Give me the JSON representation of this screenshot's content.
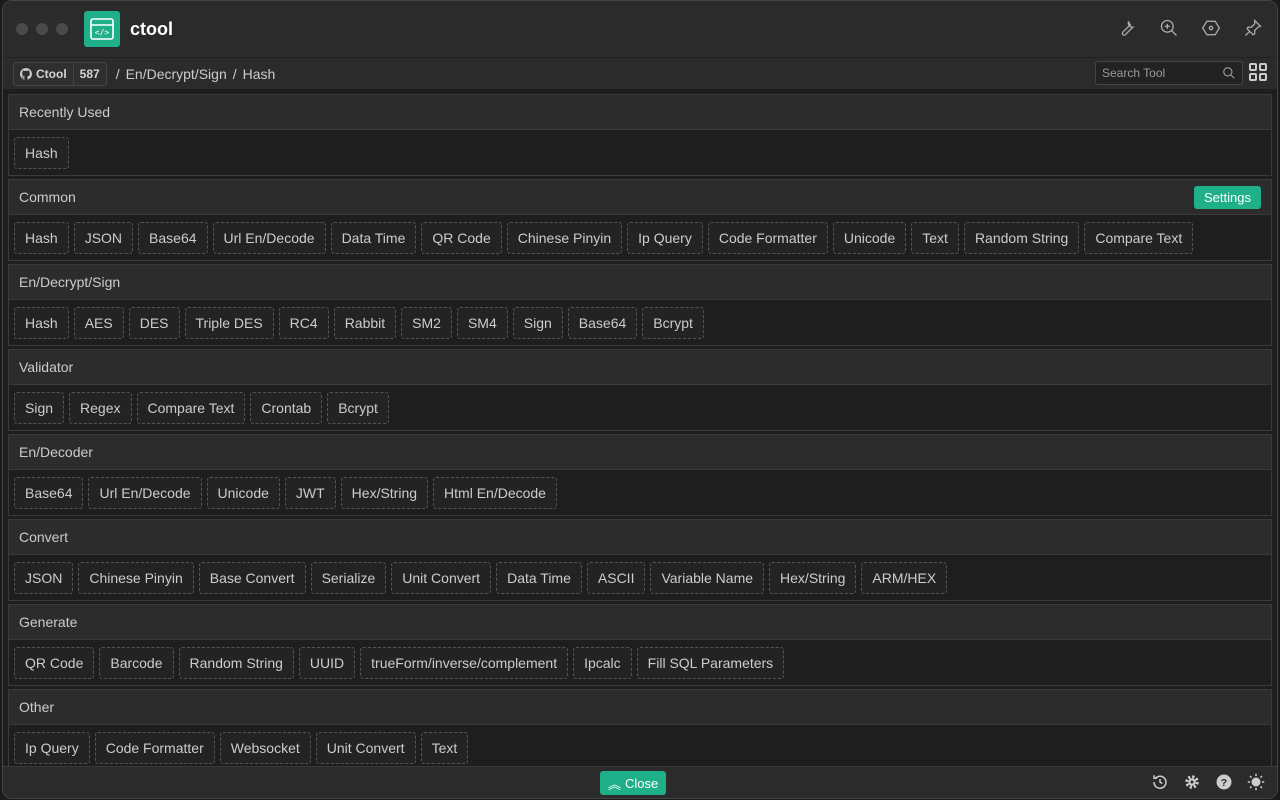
{
  "app": {
    "title": "ctool"
  },
  "nav": {
    "repo": "Ctool",
    "stars": "587",
    "breadcrumb": [
      "En/Decrypt/Sign",
      "Hash"
    ],
    "search_placeholder": "Search Tool"
  },
  "sections": [
    {
      "title": "Recently Used",
      "tools": [
        "Hash"
      ]
    },
    {
      "title": "Common",
      "action": "Settings",
      "tools": [
        "Hash",
        "JSON",
        "Base64",
        "Url En/Decode",
        "Data Time",
        "QR Code",
        "Chinese Pinyin",
        "Ip Query",
        "Code Formatter",
        "Unicode",
        "Text",
        "Random String",
        "Compare Text"
      ]
    },
    {
      "title": "En/Decrypt/Sign",
      "tools": [
        "Hash",
        "AES",
        "DES",
        "Triple DES",
        "RC4",
        "Rabbit",
        "SM2",
        "SM4",
        "Sign",
        "Base64",
        "Bcrypt"
      ]
    },
    {
      "title": "Validator",
      "tools": [
        "Sign",
        "Regex",
        "Compare Text",
        "Crontab",
        "Bcrypt"
      ]
    },
    {
      "title": "En/Decoder",
      "tools": [
        "Base64",
        "Url En/Decode",
        "Unicode",
        "JWT",
        "Hex/String",
        "Html En/Decode"
      ]
    },
    {
      "title": "Convert",
      "tools": [
        "JSON",
        "Chinese Pinyin",
        "Base Convert",
        "Serialize",
        "Unit Convert",
        "Data Time",
        "ASCII",
        "Variable Name",
        "Hex/String",
        "ARM/HEX"
      ]
    },
    {
      "title": "Generate",
      "tools": [
        "QR Code",
        "Barcode",
        "Random String",
        "UUID",
        "trueForm/inverse/complement",
        "Ipcalc",
        "Fill SQL Parameters"
      ]
    },
    {
      "title": "Other",
      "tools": [
        "Ip Query",
        "Code Formatter",
        "Websocket",
        "Unit Convert",
        "Text"
      ]
    }
  ],
  "footer": {
    "close_label": "Close"
  },
  "colors": {
    "accent": "#1fb08a"
  }
}
